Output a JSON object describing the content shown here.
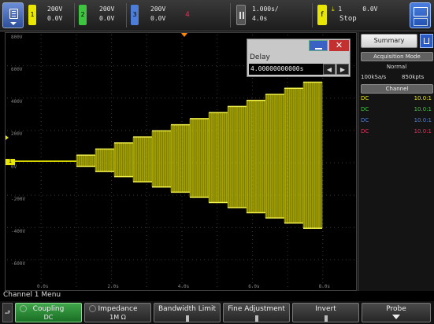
{
  "colors": {
    "ch1": "#e8e600",
    "ch2": "#3ec43e",
    "ch3": "#4c7dd8",
    "ch4": "#e0305a",
    "accent_blue": "#2d5bc6",
    "trace": "#d6d400"
  },
  "topbar": {
    "channels": [
      {
        "num": "1",
        "scale": "200V",
        "offset": "0.0V"
      },
      {
        "num": "2",
        "scale": "200V",
        "offset": "0.0V"
      },
      {
        "num": "3",
        "scale": "200V",
        "offset": "0.0V"
      },
      {
        "num": "4",
        "scale": "",
        "offset": ""
      }
    ],
    "timebase": {
      "scale": "1.000s/",
      "delay": "4.0s"
    },
    "trigger": {
      "slope": "f",
      "source": "1",
      "level": "0.0V",
      "mode": "Stop"
    },
    "icons": [
      "menu-icon",
      "pause-icon",
      "summary-icon"
    ]
  },
  "graticule": {
    "y_labels": [
      "800V",
      "600V",
      "400V",
      "200V",
      "0V",
      "-200V",
      "-400V",
      "-600V"
    ],
    "x_labels": [
      "0.0s",
      "2.0s",
      "4.0s",
      "6.0s",
      "8.0s"
    ],
    "ch_marker": "1",
    "trace_steps": 13,
    "trace_max_amp": 0.95
  },
  "delay_dialog": {
    "title": "Delay",
    "value": "4.00000000000s",
    "minimize": "—",
    "close": "✕",
    "prev": "◀",
    "next": "▶"
  },
  "sidebar": {
    "summary_tab": "Summary",
    "acq_header": "Acquisition Mode",
    "acq_mode": "Normal",
    "sample_rate": "100kSa/s",
    "memory": "850kpts",
    "channel_header": "Channel",
    "channel_rows": [
      {
        "coupling": "DC",
        "probe": "10.0:1"
      },
      {
        "coupling": "DC",
        "probe": "10.0:1"
      },
      {
        "coupling": "DC",
        "probe": "10.0:1"
      },
      {
        "coupling": "DC",
        "probe": "10.0:1"
      }
    ]
  },
  "menu": {
    "title": "Channel 1 Menu",
    "back": "⮐",
    "keys": [
      {
        "label": "Coupling",
        "value": "DC"
      },
      {
        "label": "Impedance",
        "value": "1M Ω"
      },
      {
        "label": "Bandwidth Limit",
        "value": ""
      },
      {
        "label": "Fine Adjustment",
        "value": ""
      },
      {
        "label": "Invert",
        "value": ""
      },
      {
        "label": "Probe",
        "value": ""
      }
    ]
  }
}
